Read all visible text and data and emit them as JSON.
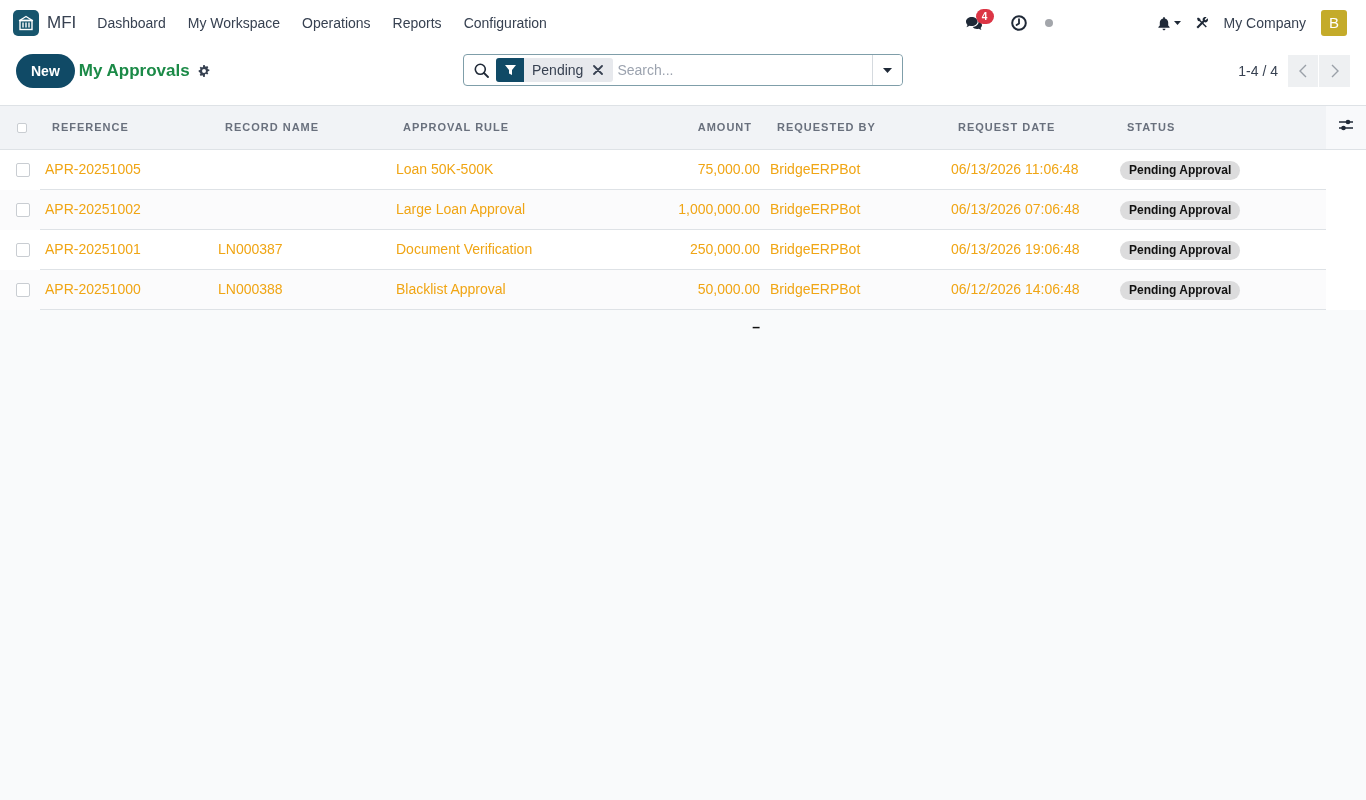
{
  "navbar": {
    "app_name": "MFI",
    "menu": [
      "Dashboard",
      "My Workspace",
      "Operations",
      "Reports",
      "Configuration"
    ],
    "message_count": "4",
    "company": "My Company",
    "avatar_initial": "B"
  },
  "control_panel": {
    "new_button": "New",
    "title": "My Approvals",
    "search": {
      "facets": [
        {
          "label": "Pending"
        }
      ],
      "placeholder": "Search..."
    },
    "pager": "1-4 / 4"
  },
  "table": {
    "select_all": {
      "checked": false
    },
    "columns": [
      {
        "label": "REFERENCE",
        "kind": "text"
      },
      {
        "label": "RECORD NAME",
        "kind": "text"
      },
      {
        "label": "APPROVAL RULE",
        "kind": "text"
      },
      {
        "label": "AMOUNT",
        "kind": "number"
      },
      {
        "label": "REQUESTED BY",
        "kind": "text"
      },
      {
        "label": "REQUEST DATE",
        "kind": "text"
      },
      {
        "label": "STATUS",
        "kind": "badge"
      }
    ],
    "rows": [
      {
        "checked": false,
        "reference": "APR-20251005",
        "approval_rule": "Loan 50K-500K",
        "amount": "75,000.00",
        "requested_by": "BridgeERPBot",
        "request_date": "06/13/2026 11:06:48",
        "status": "Pending Approval"
      },
      {
        "checked": false,
        "reference": "APR-20251002",
        "approval_rule": "Large Loan Approval",
        "amount": "1,000,000.00",
        "requested_by": "BridgeERPBot",
        "request_date": "06/13/2026 07:06:48",
        "status": "Pending Approval"
      },
      {
        "checked": false,
        "reference": "APR-20251001",
        "record_name": "LN000387",
        "approval_rule": "Document Verification",
        "amount": "250,000.00",
        "requested_by": "BridgeERPBot",
        "request_date": "06/13/2026 19:06:48",
        "status": "Pending Approval"
      },
      {
        "checked": false,
        "reference": "APR-20251000",
        "record_name": "LN000388",
        "approval_rule": "Blacklist Approval",
        "amount": "50,000.00",
        "requested_by": "BridgeERPBot",
        "request_date": "06/12/2026 14:06:48",
        "status": "Pending Approval"
      }
    ],
    "footer": {
      "amount": "–"
    }
  }
}
